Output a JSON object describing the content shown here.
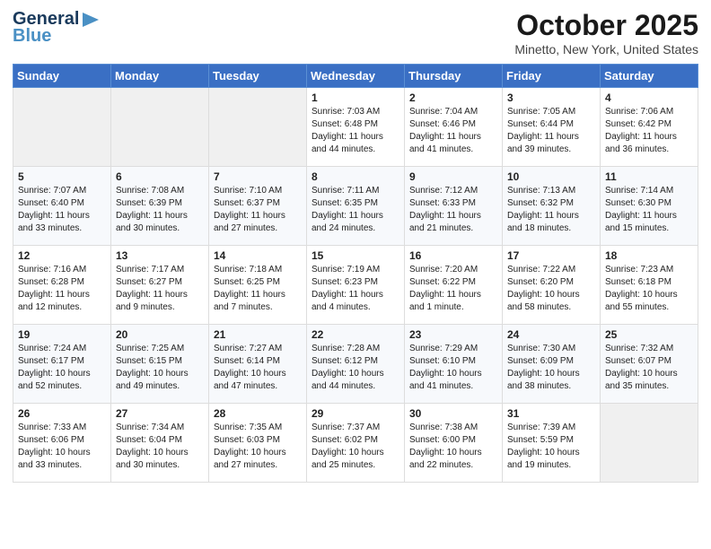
{
  "logo": {
    "line1": "General",
    "line2": "Blue"
  },
  "title": "October 2025",
  "subtitle": "Minetto, New York, United States",
  "weekdays": [
    "Sunday",
    "Monday",
    "Tuesday",
    "Wednesday",
    "Thursday",
    "Friday",
    "Saturday"
  ],
  "weeks": [
    [
      {
        "day": "",
        "sunrise": "",
        "sunset": "",
        "daylight": ""
      },
      {
        "day": "",
        "sunrise": "",
        "sunset": "",
        "daylight": ""
      },
      {
        "day": "",
        "sunrise": "",
        "sunset": "",
        "daylight": ""
      },
      {
        "day": "1",
        "sunrise": "Sunrise: 7:03 AM",
        "sunset": "Sunset: 6:48 PM",
        "daylight": "Daylight: 11 hours and 44 minutes."
      },
      {
        "day": "2",
        "sunrise": "Sunrise: 7:04 AM",
        "sunset": "Sunset: 6:46 PM",
        "daylight": "Daylight: 11 hours and 41 minutes."
      },
      {
        "day": "3",
        "sunrise": "Sunrise: 7:05 AM",
        "sunset": "Sunset: 6:44 PM",
        "daylight": "Daylight: 11 hours and 39 minutes."
      },
      {
        "day": "4",
        "sunrise": "Sunrise: 7:06 AM",
        "sunset": "Sunset: 6:42 PM",
        "daylight": "Daylight: 11 hours and 36 minutes."
      }
    ],
    [
      {
        "day": "5",
        "sunrise": "Sunrise: 7:07 AM",
        "sunset": "Sunset: 6:40 PM",
        "daylight": "Daylight: 11 hours and 33 minutes."
      },
      {
        "day": "6",
        "sunrise": "Sunrise: 7:08 AM",
        "sunset": "Sunset: 6:39 PM",
        "daylight": "Daylight: 11 hours and 30 minutes."
      },
      {
        "day": "7",
        "sunrise": "Sunrise: 7:10 AM",
        "sunset": "Sunset: 6:37 PM",
        "daylight": "Daylight: 11 hours and 27 minutes."
      },
      {
        "day": "8",
        "sunrise": "Sunrise: 7:11 AM",
        "sunset": "Sunset: 6:35 PM",
        "daylight": "Daylight: 11 hours and 24 minutes."
      },
      {
        "day": "9",
        "sunrise": "Sunrise: 7:12 AM",
        "sunset": "Sunset: 6:33 PM",
        "daylight": "Daylight: 11 hours and 21 minutes."
      },
      {
        "day": "10",
        "sunrise": "Sunrise: 7:13 AM",
        "sunset": "Sunset: 6:32 PM",
        "daylight": "Daylight: 11 hours and 18 minutes."
      },
      {
        "day": "11",
        "sunrise": "Sunrise: 7:14 AM",
        "sunset": "Sunset: 6:30 PM",
        "daylight": "Daylight: 11 hours and 15 minutes."
      }
    ],
    [
      {
        "day": "12",
        "sunrise": "Sunrise: 7:16 AM",
        "sunset": "Sunset: 6:28 PM",
        "daylight": "Daylight: 11 hours and 12 minutes."
      },
      {
        "day": "13",
        "sunrise": "Sunrise: 7:17 AM",
        "sunset": "Sunset: 6:27 PM",
        "daylight": "Daylight: 11 hours and 9 minutes."
      },
      {
        "day": "14",
        "sunrise": "Sunrise: 7:18 AM",
        "sunset": "Sunset: 6:25 PM",
        "daylight": "Daylight: 11 hours and 7 minutes."
      },
      {
        "day": "15",
        "sunrise": "Sunrise: 7:19 AM",
        "sunset": "Sunset: 6:23 PM",
        "daylight": "Daylight: 11 hours and 4 minutes."
      },
      {
        "day": "16",
        "sunrise": "Sunrise: 7:20 AM",
        "sunset": "Sunset: 6:22 PM",
        "daylight": "Daylight: 11 hours and 1 minute."
      },
      {
        "day": "17",
        "sunrise": "Sunrise: 7:22 AM",
        "sunset": "Sunset: 6:20 PM",
        "daylight": "Daylight: 10 hours and 58 minutes."
      },
      {
        "day": "18",
        "sunrise": "Sunrise: 7:23 AM",
        "sunset": "Sunset: 6:18 PM",
        "daylight": "Daylight: 10 hours and 55 minutes."
      }
    ],
    [
      {
        "day": "19",
        "sunrise": "Sunrise: 7:24 AM",
        "sunset": "Sunset: 6:17 PM",
        "daylight": "Daylight: 10 hours and 52 minutes."
      },
      {
        "day": "20",
        "sunrise": "Sunrise: 7:25 AM",
        "sunset": "Sunset: 6:15 PM",
        "daylight": "Daylight: 10 hours and 49 minutes."
      },
      {
        "day": "21",
        "sunrise": "Sunrise: 7:27 AM",
        "sunset": "Sunset: 6:14 PM",
        "daylight": "Daylight: 10 hours and 47 minutes."
      },
      {
        "day": "22",
        "sunrise": "Sunrise: 7:28 AM",
        "sunset": "Sunset: 6:12 PM",
        "daylight": "Daylight: 10 hours and 44 minutes."
      },
      {
        "day": "23",
        "sunrise": "Sunrise: 7:29 AM",
        "sunset": "Sunset: 6:10 PM",
        "daylight": "Daylight: 10 hours and 41 minutes."
      },
      {
        "day": "24",
        "sunrise": "Sunrise: 7:30 AM",
        "sunset": "Sunset: 6:09 PM",
        "daylight": "Daylight: 10 hours and 38 minutes."
      },
      {
        "day": "25",
        "sunrise": "Sunrise: 7:32 AM",
        "sunset": "Sunset: 6:07 PM",
        "daylight": "Daylight: 10 hours and 35 minutes."
      }
    ],
    [
      {
        "day": "26",
        "sunrise": "Sunrise: 7:33 AM",
        "sunset": "Sunset: 6:06 PM",
        "daylight": "Daylight: 10 hours and 33 minutes."
      },
      {
        "day": "27",
        "sunrise": "Sunrise: 7:34 AM",
        "sunset": "Sunset: 6:04 PM",
        "daylight": "Daylight: 10 hours and 30 minutes."
      },
      {
        "day": "28",
        "sunrise": "Sunrise: 7:35 AM",
        "sunset": "Sunset: 6:03 PM",
        "daylight": "Daylight: 10 hours and 27 minutes."
      },
      {
        "day": "29",
        "sunrise": "Sunrise: 7:37 AM",
        "sunset": "Sunset: 6:02 PM",
        "daylight": "Daylight: 10 hours and 25 minutes."
      },
      {
        "day": "30",
        "sunrise": "Sunrise: 7:38 AM",
        "sunset": "Sunset: 6:00 PM",
        "daylight": "Daylight: 10 hours and 22 minutes."
      },
      {
        "day": "31",
        "sunrise": "Sunrise: 7:39 AM",
        "sunset": "Sunset: 5:59 PM",
        "daylight": "Daylight: 10 hours and 19 minutes."
      },
      {
        "day": "",
        "sunrise": "",
        "sunset": "",
        "daylight": ""
      }
    ]
  ]
}
